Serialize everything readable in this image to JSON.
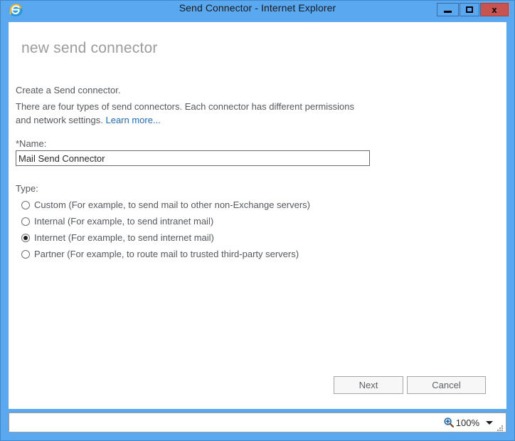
{
  "window": {
    "title": "Send Connector - Internet Explorer",
    "app_icon": "internet-explorer-icon",
    "controls": {
      "minimize": "–",
      "maximize": "□",
      "close": "x"
    },
    "colors": {
      "frame": "#5aa9f0",
      "close_button": "#c75450",
      "link": "#1f6bb8",
      "body_text": "#54595e",
      "heading": "#9c9c9c"
    }
  },
  "page": {
    "heading": "new send connector",
    "intro_line_1": "Create a Send connector.",
    "intro_line_2": "There are four types of send connectors. Each connector has different permissions and network settings.",
    "learn_more_label": "Learn more...",
    "name_label": "*Name:",
    "name_value": "Mail Send Connector",
    "name_placeholder": "",
    "type_label": "Type:",
    "type_options": [
      {
        "label": "Custom (For example, to send mail to other non-Exchange servers)",
        "selected": false
      },
      {
        "label": "Internal (For example, to send intranet mail)",
        "selected": false
      },
      {
        "label": "Internet (For example, to send internet mail)",
        "selected": true
      },
      {
        "label": "Partner (For example, to route mail to trusted third-party servers)",
        "selected": false
      }
    ],
    "selected_type": "Internet (For example, to send internet mail)",
    "buttons": {
      "next": "Next",
      "cancel": "Cancel"
    }
  },
  "status_bar": {
    "zoom_icon": "magnifier-plus-icon",
    "zoom_level": "100%",
    "caret_icon": "chevron-down-icon",
    "grip_icon": "resize-grip-icon"
  }
}
